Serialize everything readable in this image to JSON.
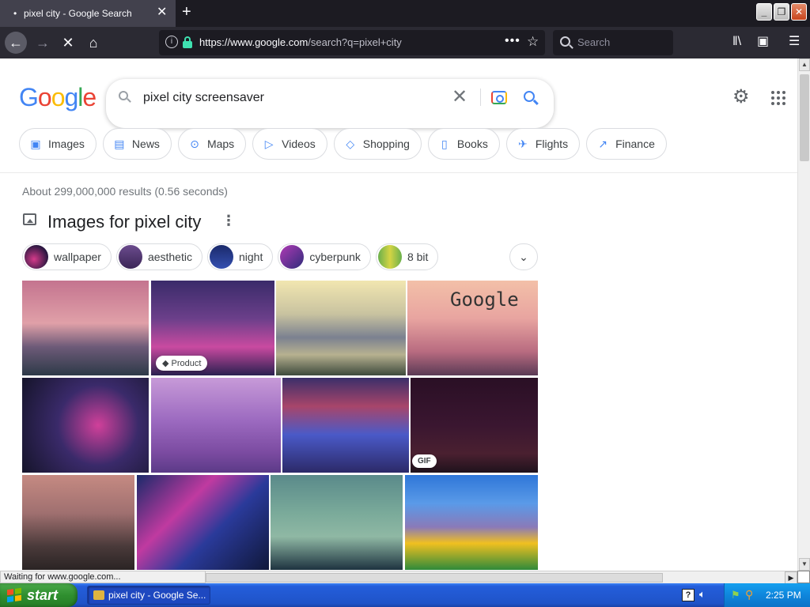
{
  "browser": {
    "tab_title": "pixel city - Google Search",
    "tab_indicator": "•",
    "close_tab": "✕",
    "new_tab": "+",
    "url_domain": "https://www.google.com",
    "url_path": "/search?q=pixel+city",
    "search_placeholder": "Search",
    "window_buttons": {
      "minimize": "_",
      "restore": "❐",
      "close": "✕"
    }
  },
  "google": {
    "logo_letters": [
      "G",
      "o",
      "o",
      "g",
      "l",
      "e"
    ],
    "query": "pixel city screensaver",
    "clear": "✕",
    "colors": {
      "blue": "#4285f4",
      "red": "#ea4335",
      "yellow": "#fbbc05",
      "green": "#34a853"
    }
  },
  "tabs": [
    {
      "label": "Images",
      "icon": "image-icon"
    },
    {
      "label": "News",
      "icon": "news-icon"
    },
    {
      "label": "Maps",
      "icon": "map-pin-icon"
    },
    {
      "label": "Videos",
      "icon": "play-icon"
    },
    {
      "label": "Shopping",
      "icon": "tag-icon"
    },
    {
      "label": "Books",
      "icon": "book-icon"
    },
    {
      "label": "Flights",
      "icon": "airplane-icon"
    },
    {
      "label": "Finance",
      "icon": "chart-icon"
    }
  ],
  "results": {
    "stats": "About 299,000,000 results (0.56 seconds)",
    "images_heading": "Images for pixel city"
  },
  "refinements": [
    {
      "label": "wallpaper"
    },
    {
      "label": "aesthetic"
    },
    {
      "label": "night"
    },
    {
      "label": "cyberpunk"
    },
    {
      "label": "8 bit"
    }
  ],
  "image_tiles": {
    "product_badge": "Product",
    "gif_badge": "GIF",
    "google_tile_text": "Google"
  },
  "status_bar": {
    "text": "Waiting for www.google.com..."
  },
  "taskbar": {
    "start_label": "start",
    "window_item": "pixel city - Google Se...",
    "help": "?",
    "clock": "2:25 PM",
    "start_flag_colors": [
      "#f25022",
      "#7fba00",
      "#00a4ef",
      "#ffb900"
    ]
  }
}
